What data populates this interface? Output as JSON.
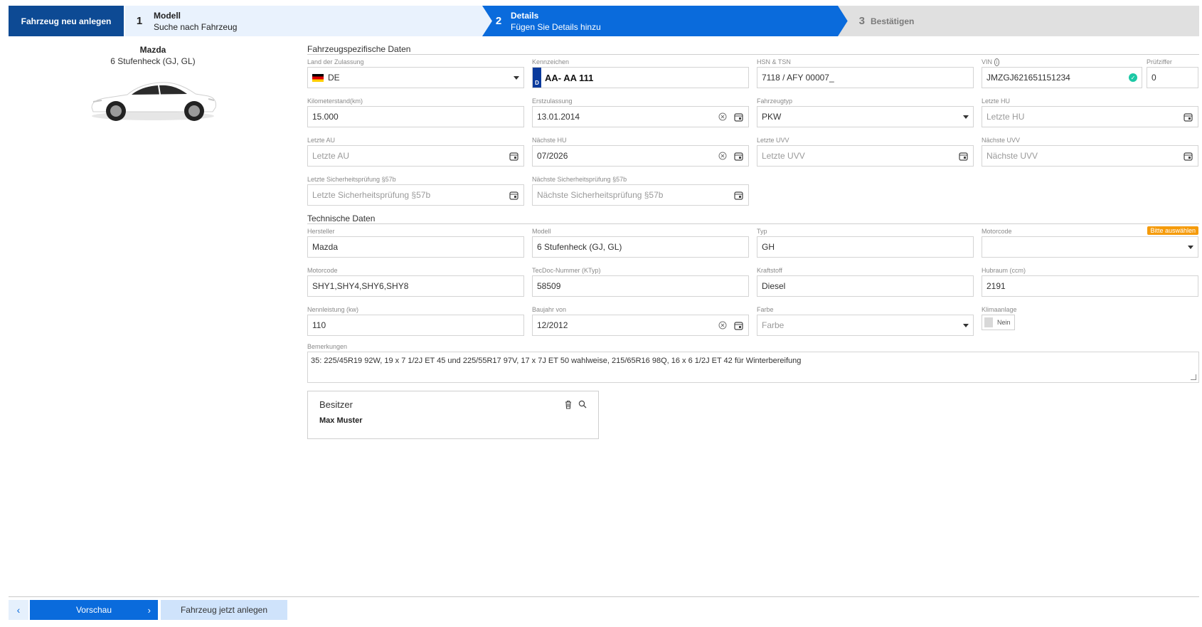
{
  "stepper": {
    "title": "Fahrzeug neu anlegen",
    "steps": [
      {
        "num": "1",
        "title": "Modell",
        "subtitle": "Suche nach Fahrzeug"
      },
      {
        "num": "2",
        "title": "Details",
        "subtitle": "Fügen Sie Details hinzu"
      },
      {
        "num": "3",
        "title": "Bestätigen"
      }
    ],
    "active_step": 2
  },
  "vehicle": {
    "make": "Mazda",
    "model": "6 Stufenheck (GJ, GL)"
  },
  "sections": {
    "vehicle_data": "Fahrzeugspezifische Daten",
    "technical_data": "Technische Daten"
  },
  "fields": {
    "land": {
      "label": "Land der Zulassung",
      "value": "DE"
    },
    "kennzeichen": {
      "label": "Kennzeichen",
      "plate_country": "D",
      "value": "AA- AA 111"
    },
    "hsn": {
      "label": "HSN & TSN",
      "value": "7118 / AFY 00007_"
    },
    "vin": {
      "label": "VIN",
      "value": "JMZGJ621651151234"
    },
    "pruefziffer": {
      "label": "Prüfziffer",
      "value": "0"
    },
    "km": {
      "label": "Kilometerstand(km)",
      "value": "15.000"
    },
    "erstzulassung": {
      "label": "Erstzulassung",
      "value": "13.01.2014"
    },
    "fahrzeugtyp": {
      "label": "Fahrzeugtyp",
      "value": "PKW"
    },
    "letzte_hu": {
      "label": "Letzte HU",
      "placeholder": "Letzte HU"
    },
    "letzte_au": {
      "label": "Letzte AU",
      "placeholder": "Letzte AU"
    },
    "naechste_hu": {
      "label": "Nächste HU",
      "value": "07/2026"
    },
    "letzte_uvv": {
      "label": "Letzte UVV",
      "placeholder": "Letzte UVV"
    },
    "naechste_uvv": {
      "label": "Nächste UVV",
      "placeholder": "Nächste UVV"
    },
    "letzte_sp": {
      "label": "Letzte Sicherheitsprüfung §57b",
      "placeholder": "Letzte Sicherheitsprüfung §57b"
    },
    "naechste_sp": {
      "label": "Nächste Sicherheitsprüfung §57b",
      "placeholder": "Nächste Sicherheitsprüfung §57b"
    },
    "hersteller": {
      "label": "Hersteller",
      "value": "Mazda"
    },
    "modell": {
      "label": "Modell",
      "value": "6 Stufenheck (GJ, GL)"
    },
    "typ": {
      "label": "Typ",
      "value": "GH"
    },
    "motorcode_select": {
      "label": "Motorcode",
      "badge": "Bitte auswählen",
      "value": ""
    },
    "motorcode": {
      "label": "Motorcode",
      "value": "SHY1,SHY4,SHY6,SHY8"
    },
    "tecdoc": {
      "label": "TecDoc-Nummer (KTyp)",
      "value": "58509"
    },
    "kraftstoff": {
      "label": "Kraftstoff",
      "value": "Diesel"
    },
    "hubraum": {
      "label": "Hubraum (ccm)",
      "value": "2191"
    },
    "nennleistung": {
      "label": "Nennleistung (kw)",
      "value": "110"
    },
    "baujahr": {
      "label": "Baujahr von",
      "value": "12/2012"
    },
    "farbe": {
      "label": "Farbe",
      "placeholder": "Farbe"
    },
    "klima": {
      "label": "Klimaanlage",
      "value": "Nein"
    },
    "bemerkungen": {
      "label": "Bemerkungen",
      "value": "35: 225/45R19 92W, 19 x 7 1/2J ET 45 und 225/55R17 97V, 17 x 7J ET 50 wahlweise, 215/65R16 98Q, 16 x 6 1/2J ET 42 für Winterbereifung"
    }
  },
  "owner": {
    "title": "Besitzer",
    "name": "Max Muster"
  },
  "footer": {
    "back": "‹",
    "preview": "Vorschau",
    "create": "Fahrzeug jetzt anlegen"
  },
  "colors": {
    "primary": "#0a6bdc",
    "title_dark": "#0d4a94",
    "badge": "#f59b0b",
    "ok": "#1cc8a5"
  }
}
